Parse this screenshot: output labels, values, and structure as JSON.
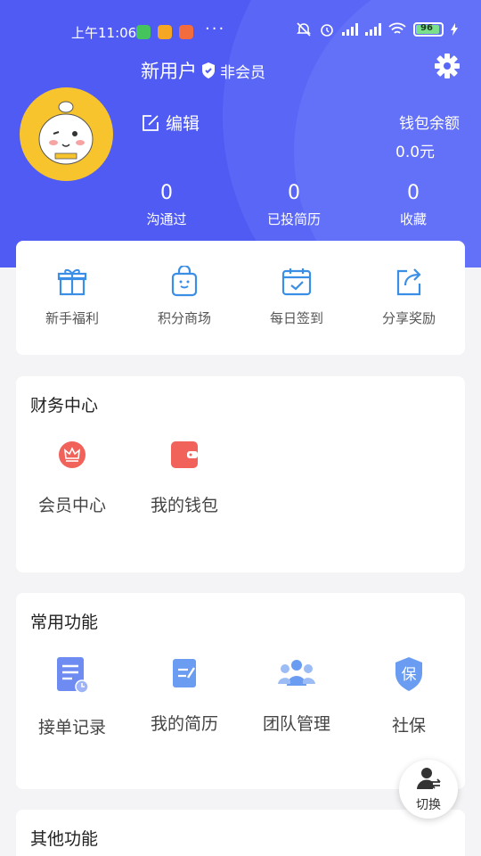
{
  "status_bar": {
    "time": "上午11:06",
    "more": "···",
    "battery": "96"
  },
  "profile": {
    "username": "新用户",
    "member_status": "非会员",
    "edit_label": "编辑",
    "wallet_label": "钱包余额",
    "wallet_value": "0.0元",
    "settings_icon": "gear-icon"
  },
  "stats": [
    {
      "value": "0",
      "label": "沟通过"
    },
    {
      "value": "0",
      "label": "已投简历"
    },
    {
      "value": "0",
      "label": "收藏"
    }
  ],
  "quick_actions": [
    {
      "label": "新手福利",
      "icon": "gift-icon"
    },
    {
      "label": "积分商场",
      "icon": "shopping-bag-icon"
    },
    {
      "label": "每日签到",
      "icon": "calendar-check-icon"
    },
    {
      "label": "分享奖励",
      "icon": "share-icon"
    }
  ],
  "finance": {
    "title": "财务中心",
    "items": [
      {
        "label": "会员中心",
        "icon": "crown-icon"
      },
      {
        "label": "我的钱包",
        "icon": "wallet-icon"
      }
    ]
  },
  "common": {
    "title": "常用功能",
    "items": [
      {
        "label": "接单记录",
        "icon": "order-record-icon"
      },
      {
        "label": "我的简历",
        "icon": "resume-icon"
      },
      {
        "label": "团队管理",
        "icon": "team-icon"
      },
      {
        "label": "社保",
        "icon": "social-security-shield-icon",
        "badge_text": "保"
      }
    ]
  },
  "other": {
    "title": "其他功能"
  },
  "switch_button": {
    "label": "切换",
    "icon": "switch-user-icon"
  },
  "colors": {
    "header_blue": "#4f5bf3",
    "accent_blue": "#3a8ee6",
    "finance_red": "#f0625a",
    "background": "#f4f4f6"
  }
}
